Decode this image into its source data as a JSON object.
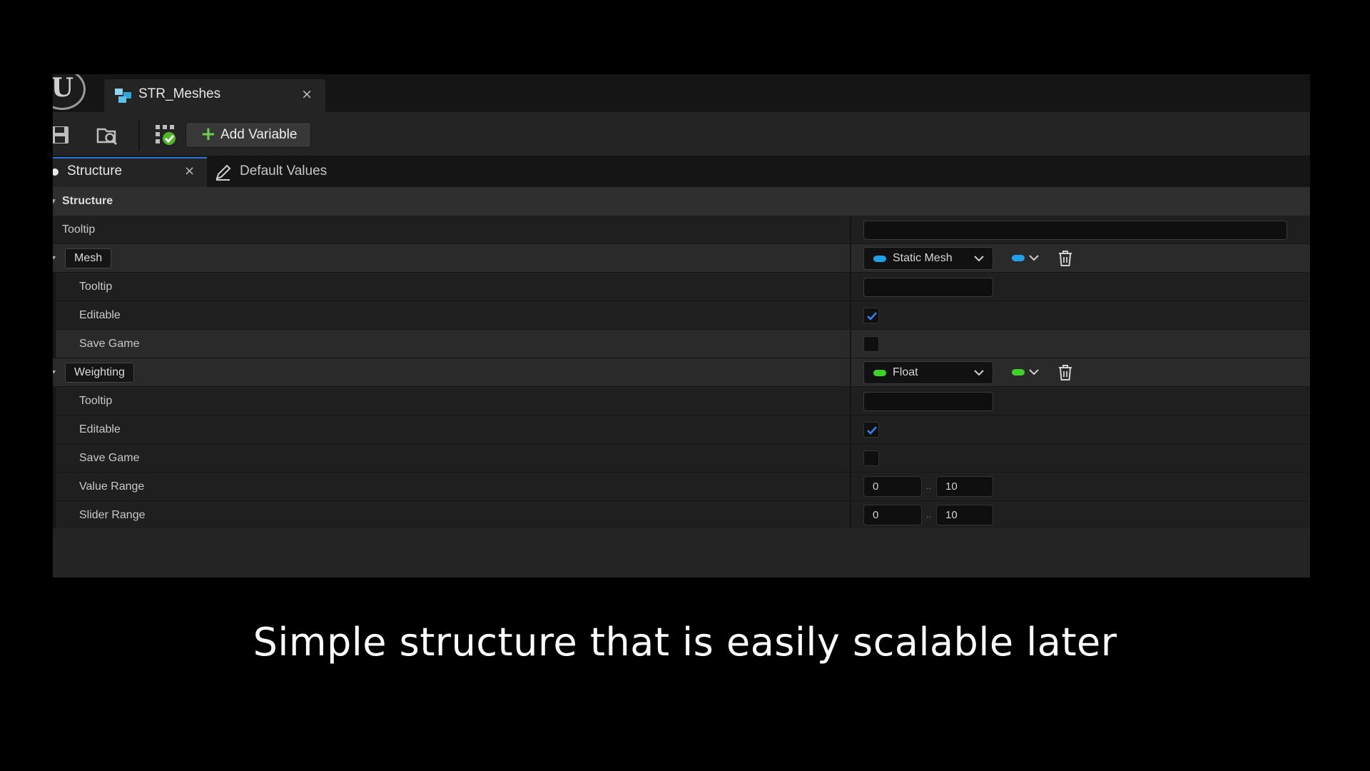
{
  "document_tab": {
    "title": "STR_Meshes",
    "close": "×",
    "icon": "user-defined-struct-icon"
  },
  "toolbar": {
    "add_variable_label": "Add Variable",
    "icons": [
      "save-icon",
      "browse-icon",
      "check-status-icon"
    ]
  },
  "panel_tabs": {
    "structure": {
      "label": "Structure",
      "close": "×"
    },
    "default_values": {
      "label": "Default Values"
    }
  },
  "section": {
    "title": "Structure"
  },
  "rows": {
    "top_tooltip": "Tooltip",
    "mesh": {
      "name": "Mesh",
      "type": "Static Mesh",
      "type_color": "#1fa0e8",
      "tooltip_label": "Tooltip",
      "editable_label": "Editable",
      "editable": true,
      "save_game_label": "Save Game",
      "save_game": false
    },
    "weighting": {
      "name": "Weighting",
      "type": "Float",
      "type_color": "#3fd12a",
      "tooltip_label": "Tooltip",
      "editable_label": "Editable",
      "editable": true,
      "save_game_label": "Save Game",
      "save_game": false,
      "value_range_label": "Value Range",
      "value_range_min": "0",
      "value_range_max": "10",
      "slider_range_label": "Slider Range",
      "slider_range_min": "0",
      "slider_range_max": "10",
      "range_separator": ".."
    }
  },
  "caption": "Simple structure that is easily scalable later"
}
